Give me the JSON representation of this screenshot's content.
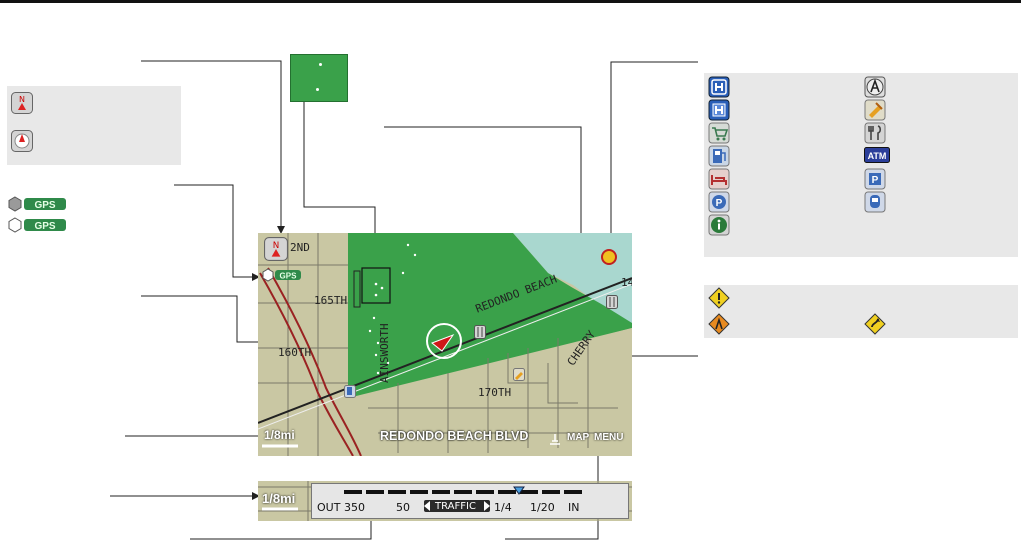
{
  "map": {
    "street_labels": [
      "2ND",
      "165TH",
      "160TH",
      "170TH",
      "REDONDO BEACH",
      "AINSWORTH",
      "CHERRY",
      "14"
    ],
    "current_street": "REDONDO BEACH BLVD",
    "scale_label": "1/8mi",
    "map_button": "MAP",
    "menu_button": "MENU",
    "north_label": "N"
  },
  "gps_label": "GPS",
  "scale_strip": {
    "scale_label": "1/8mi",
    "traffic_scale": [
      "OUT",
      "350",
      "50",
      "TRAFFIC",
      "1/4",
      "1/20",
      "IN"
    ]
  },
  "landmark_icons": [
    "honda-dealer-icon",
    "acura-dealer-icon",
    "hospital-icon",
    "school-icon",
    "shopping-icon",
    "restaurant-icon",
    "gas-station-icon",
    "atm-icon",
    "hotel-icon",
    "parking-lot-icon",
    "parking-garage-icon",
    "train-station-icon",
    "information-icon"
  ],
  "atm_label": "ATM",
  "traffic_icons": [
    "incident-icon",
    "construction-icon",
    "road-closure-icon"
  ],
  "colors": {
    "park_green": "#3aa14a",
    "water": "#a9d7cf",
    "land": "#c9c7a3",
    "road": "#9a2222"
  }
}
